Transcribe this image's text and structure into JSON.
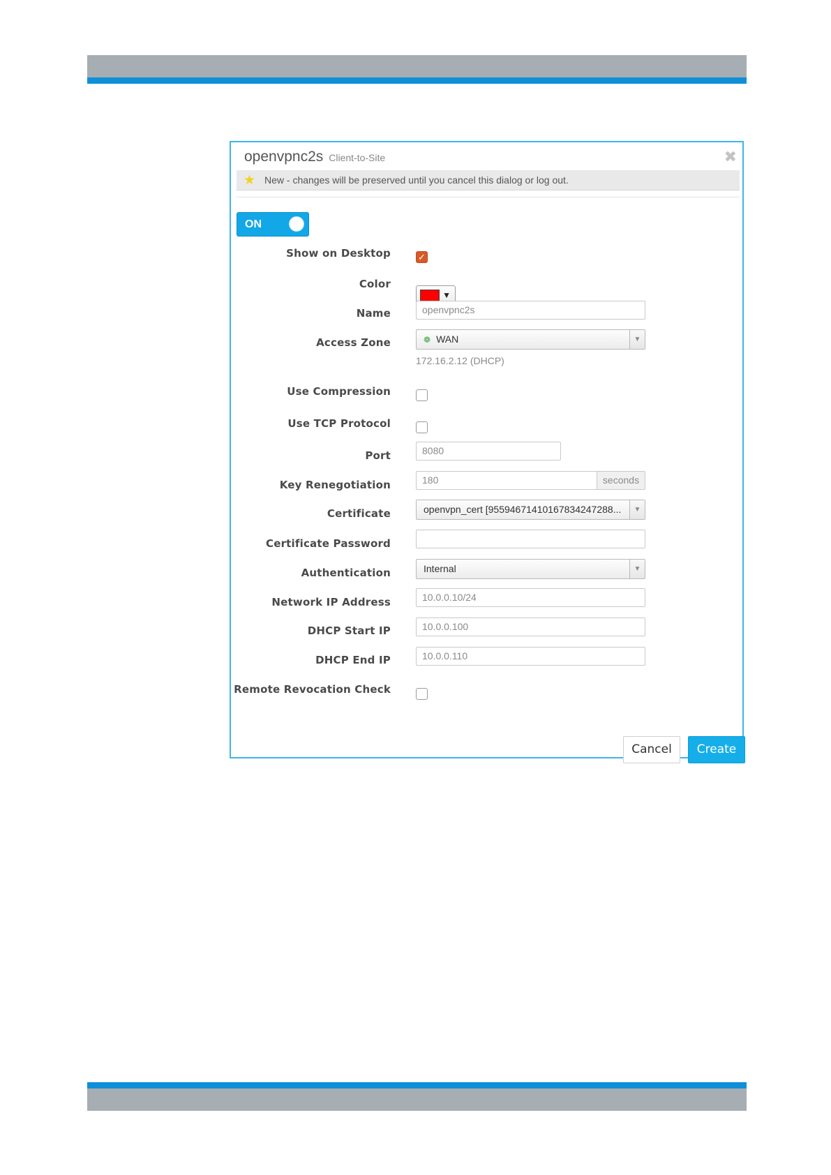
{
  "dialog": {
    "title": "openvpnc2s",
    "subtitle": "Client-to-Site",
    "close_icon": "✖",
    "notice": "New - changes will be preserved until you cancel this dialog or log out.",
    "toggle_label": "ON"
  },
  "fields": {
    "show_on_desktop": {
      "label": "Show on Desktop",
      "checked": true
    },
    "color": {
      "label": "Color",
      "value": "#ff0000"
    },
    "name": {
      "label": "Name",
      "value": "openvpnc2s"
    },
    "access_zone": {
      "label": "Access Zone",
      "value": "WAN",
      "hint": "172.16.2.12 (DHCP)"
    },
    "use_compression": {
      "label": "Use Compression",
      "checked": false
    },
    "use_tcp_protocol": {
      "label": "Use TCP Protocol",
      "checked": false
    },
    "port": {
      "label": "Port",
      "value": "8080"
    },
    "key_renegotiation": {
      "label": "Key Renegotiation",
      "value": "180",
      "unit": "seconds"
    },
    "certificate": {
      "label": "Certificate",
      "value": "openvpn_cert [95594671410167834247288..."
    },
    "certificate_password": {
      "label": "Certificate Password",
      "value": ""
    },
    "authentication": {
      "label": "Authentication",
      "value": "Internal"
    },
    "network_ip_address": {
      "label": "Network IP Address",
      "value": "10.0.0.10/24"
    },
    "dhcp_start_ip": {
      "label": "DHCP Start IP",
      "value": "10.0.0.100"
    },
    "dhcp_end_ip": {
      "label": "DHCP End IP",
      "value": "10.0.0.110"
    },
    "remote_revocation_check": {
      "label": "Remote Revocation Check",
      "checked": false
    }
  },
  "buttons": {
    "cancel": "Cancel",
    "create": "Create"
  },
  "colors": {
    "accent": "#15aee9",
    "band_gray": "#a6adb3",
    "band_blue": "#0f8fd8",
    "check": "#d85a2b"
  }
}
